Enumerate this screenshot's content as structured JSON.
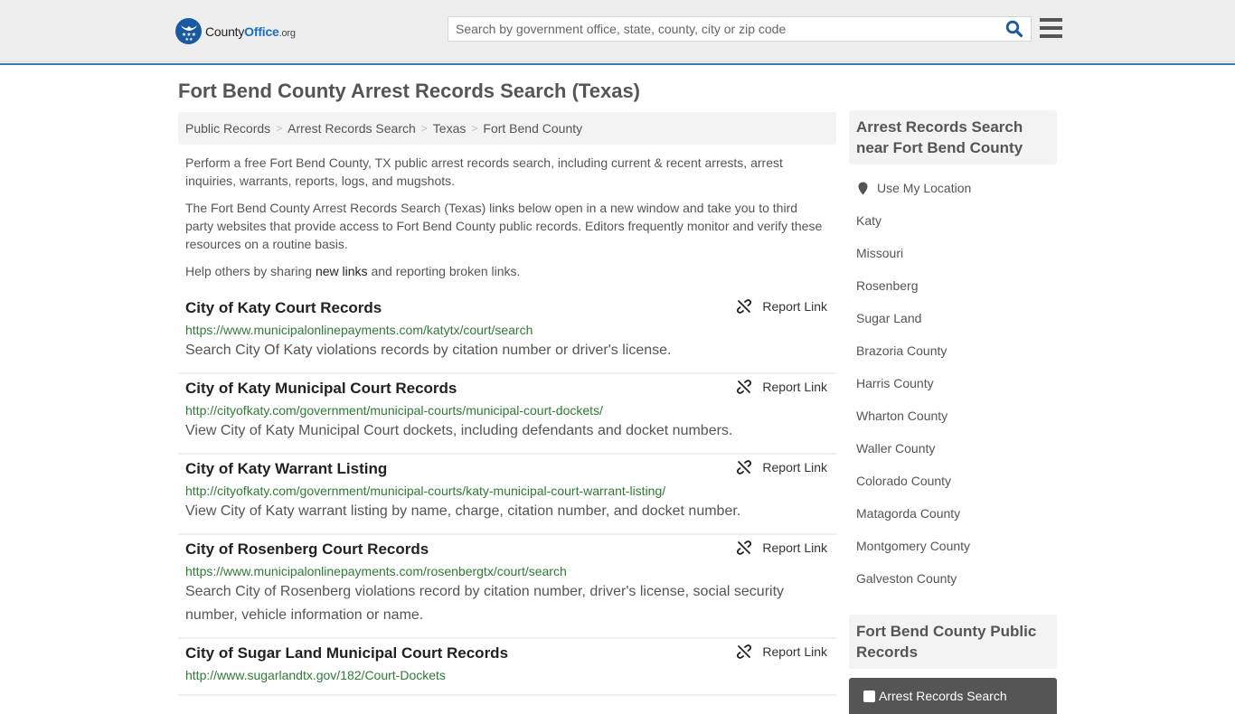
{
  "header": {
    "logo": {
      "brand_county": "County",
      "brand_office": "Office",
      "brand_tld": ".org",
      "icon": "eagle-stars-logo-icon"
    },
    "search": {
      "placeholder": "Search by government office, state, county, city or zip code",
      "value": "",
      "icon": "search-icon"
    },
    "menu_icon": "hamburger-menu-icon"
  },
  "page": {
    "title": "Fort Bend County Arrest Records Search (Texas)",
    "breadcrumb": [
      "Public Records",
      "Arrest Records Search",
      "Texas",
      "Fort Bend County"
    ],
    "breadcrumb_separator": ">"
  },
  "intro": {
    "p1": "Perform a free Fort Bend County, TX public arrest records search, including current & recent arrests, arrest inquiries, warrants, reports, logs, and mugshots.",
    "p2": "The Fort Bend County Arrest Records Search (Texas) links below open in a new window and take you to third party websites that provide access to Fort Bend County public records. Editors frequently monitor and verify these resources on a routine basis.",
    "p3_before": "Help others by sharing ",
    "p3_link": "new links",
    "p3_after": " and reporting broken links."
  },
  "report_label": "Report Link",
  "report_icon": "broken-link-icon",
  "results": [
    {
      "title": "City of Katy Court Records",
      "url": "https://www.municipalonlinepayments.com/katytx/court/search",
      "description": "Search City Of Katy violations records by citation number or driver's license."
    },
    {
      "title": "City of Katy Municipal Court Records",
      "url": "http://cityofkaty.com/government/municipal-courts/municipal-court-dockets/",
      "description": "View City of Katy Municipal Court dockets, including defendants and docket numbers."
    },
    {
      "title": "City of Katy Warrant Listing",
      "url": "http://cityofkaty.com/government/municipal-courts/katy-municipal-court-warrant-listing/",
      "description": "View City of Katy warrant listing by name, charge, citation number, and docket number."
    },
    {
      "title": "City of Rosenberg Court Records",
      "url": "https://www.municipalonlinepayments.com/rosenbergtx/court/search",
      "description": "Search City of Rosenberg violations record by citation number, driver's license, social security number, vehicle information or name."
    },
    {
      "title": "City of Sugar Land Municipal Court Records",
      "url": "http://www.sugarlandtx.gov/182/Court-Dockets",
      "description": ""
    }
  ],
  "sidebar": {
    "nearby_heading": "Arrest Records Search near Fort Bend County",
    "use_location": "Use My Location",
    "location_icon": "map-pin-icon",
    "nearby": [
      "Katy",
      "Missouri",
      "Rosenberg",
      "Sugar Land",
      "Brazoria County",
      "Harris County",
      "Wharton County",
      "Waller County",
      "Colorado County",
      "Matagorda County",
      "Montgomery County",
      "Galveston County"
    ],
    "public_records_heading": "Fort Bend County Public Records",
    "public_records_first": "Arrest Records Search"
  },
  "colors": {
    "accent_blue": "#3a7cb0",
    "logo_blue": "#1a5aa0",
    "url_green": "#2f7a36",
    "text_gray": "#555555"
  }
}
